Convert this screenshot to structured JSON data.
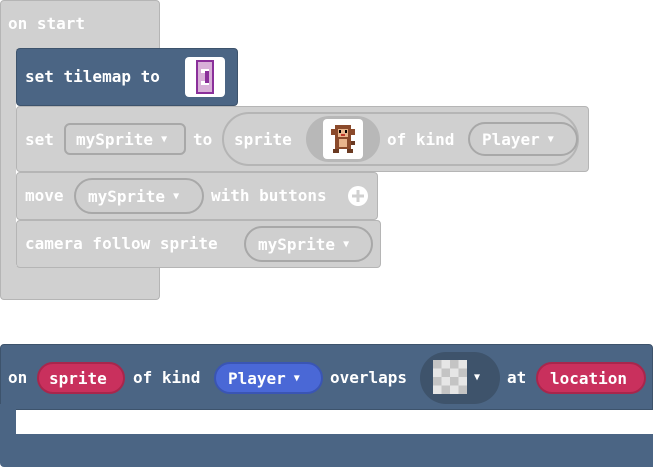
{
  "on_start": {
    "hat_label": "on start",
    "set_tilemap": {
      "label": "set tilemap to",
      "icon": "tilemap-thumbnail-icon"
    },
    "set_sprite": {
      "set_label": "set",
      "variable": "mySprite",
      "to_label": "to",
      "sprite_label": "sprite",
      "sprite_image": "monkey-sprite-icon",
      "of_kind_label": "of kind",
      "kind": "Player"
    },
    "move": {
      "label": "move",
      "variable": "mySprite",
      "with_label": "with buttons",
      "add_icon": "plus-circle-icon"
    },
    "camera": {
      "label": "camera follow sprite",
      "variable": "mySprite"
    }
  },
  "overlap_event": {
    "on_label": "on",
    "sprite_var": "sprite",
    "of_kind_label": "of kind",
    "kind": "Player",
    "overlaps_label": "overlaps",
    "tile_image": "checker-tile-icon",
    "at_label": "at",
    "location_var": "location"
  },
  "colors": {
    "loops_gray": "#d0d0d0",
    "loops_border": "#b5b5b5",
    "scene_blue": "#4b6584",
    "kind_blue": "#4a68d6",
    "variable_red": "#c9305d"
  }
}
